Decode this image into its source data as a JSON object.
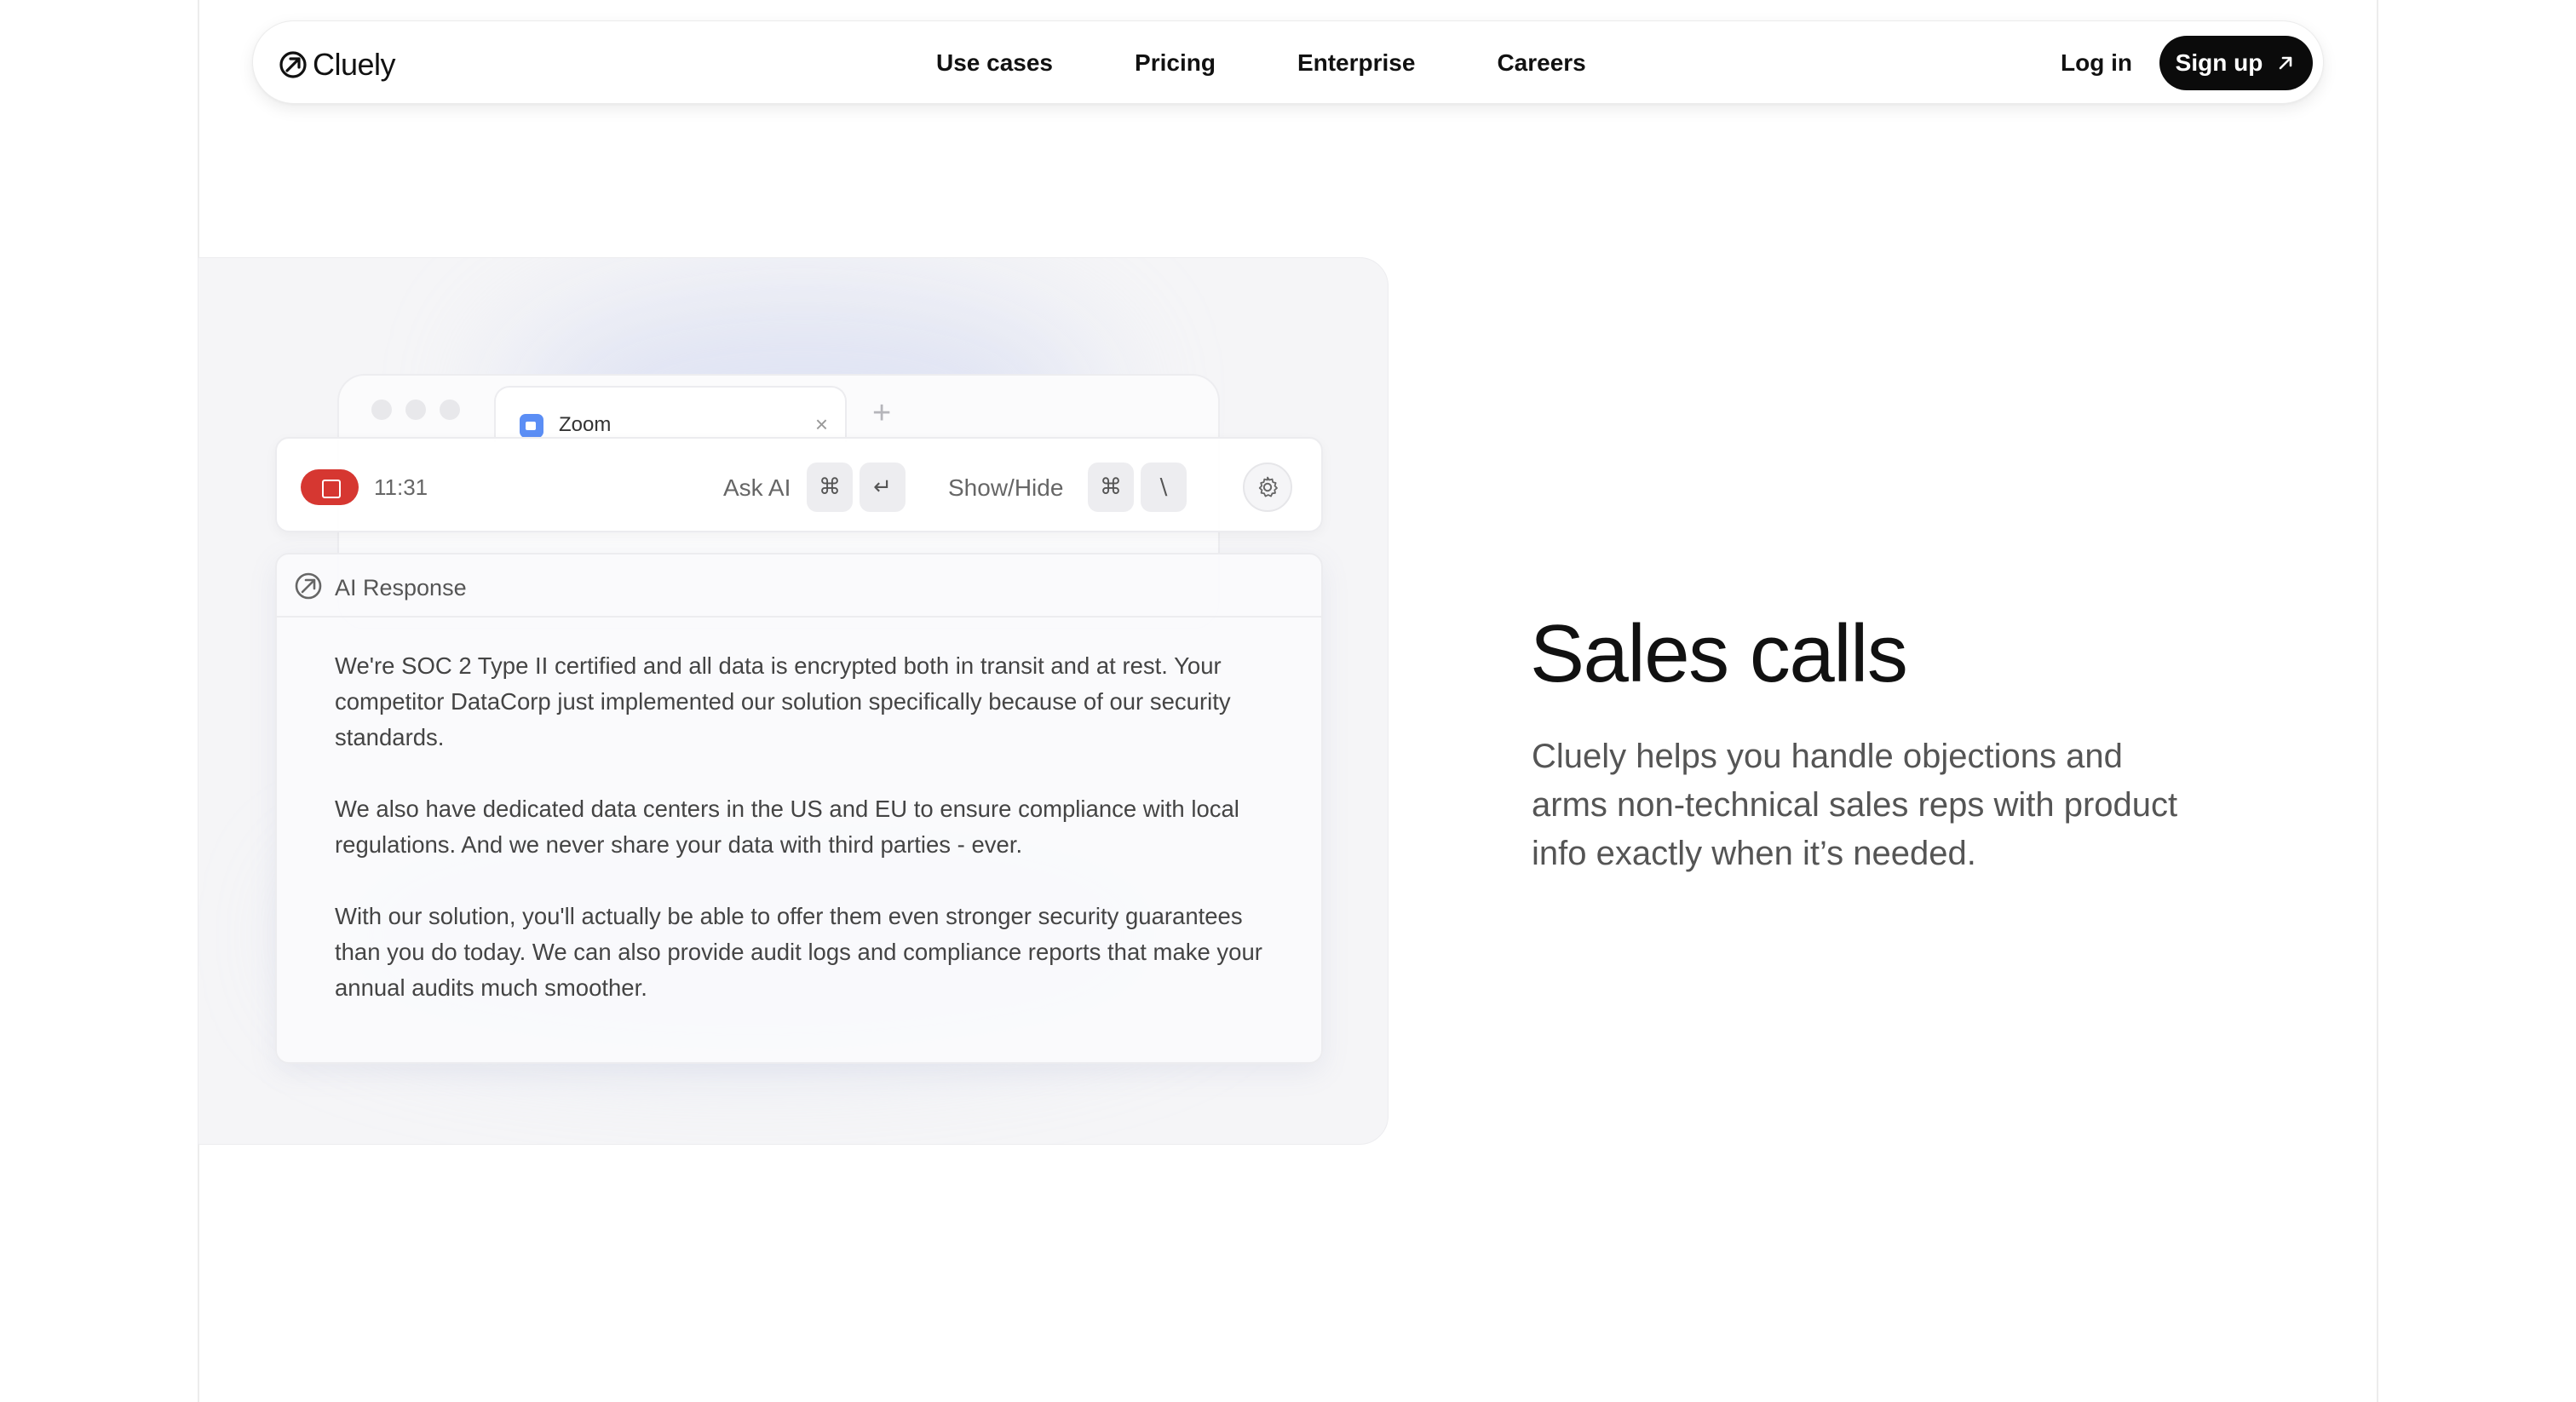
{
  "nav": {
    "logo_text": "Cluely",
    "links": [
      "Use cases",
      "Pricing",
      "Enterprise",
      "Careers"
    ],
    "login_label": "Log in",
    "signup_label": "Sign up"
  },
  "demo": {
    "browser_tab": {
      "label": "Zoom",
      "close": "×",
      "new_tab": "+"
    },
    "toolbar": {
      "timer": "11:31",
      "ask_ai_label": "Ask AI",
      "ask_ai_keys": [
        "⌘",
        "↵"
      ],
      "show_hide_label": "Show/Hide",
      "show_hide_keys": [
        "⌘",
        "\\"
      ]
    },
    "response": {
      "title": "AI Response",
      "paragraphs": [
        "We're SOC 2 Type II certified and all data is encrypted both in transit and at rest. Your competitor DataCorp just implemented our solution specifically because of our security standards.",
        "We also have dedicated data centers in the US and EU to ensure compliance with local regulations. And we never share your data with third parties - ever.",
        "With our solution, you'll actually be able to offer them even stronger security guarantees than you do today. We can also provide audit logs and compliance reports that make your annual audits much smoother."
      ]
    }
  },
  "feature": {
    "title": "Sales calls",
    "description": "Cluely helps you handle objections and arms non-technical sales reps with product info exactly when it’s needed."
  },
  "colors": {
    "record": "#d63731",
    "signup_bg": "#0b0b0b",
    "zoom_blue": "#5b8ef5"
  }
}
